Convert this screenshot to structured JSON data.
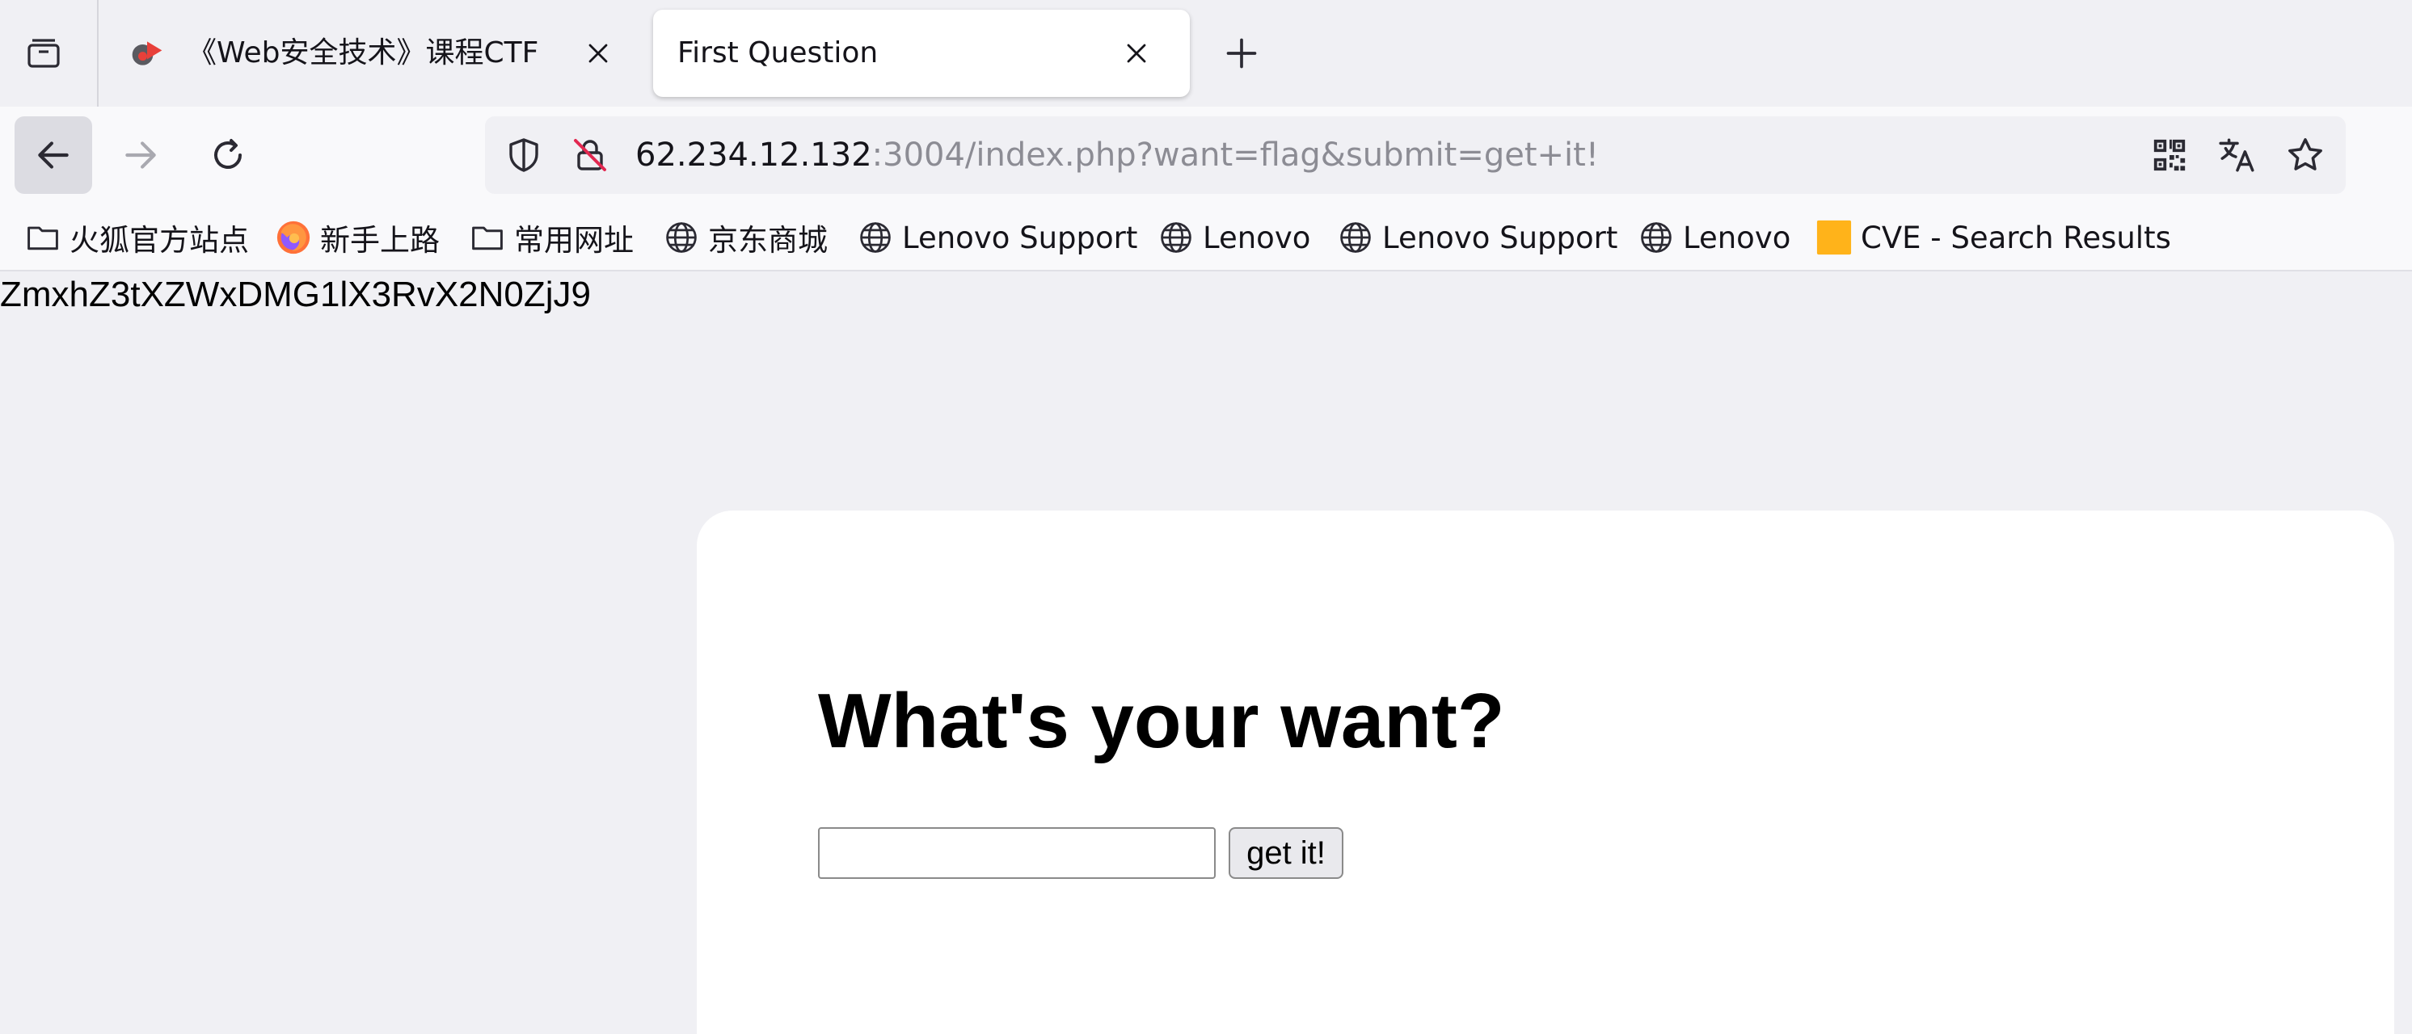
{
  "tabs": [
    {
      "title": "《Web安全技术》课程CTF",
      "active": false,
      "favicon": "red-play-favicon-icon"
    },
    {
      "title": "First Question",
      "active": true
    }
  ],
  "toolbar": {
    "tab_list_icon": "tab-list-icon",
    "new_tab_icon": "plus-icon",
    "back_icon": "arrow-left-icon",
    "forward_icon": "arrow-right-icon",
    "reload_icon": "reload-icon"
  },
  "urlbar": {
    "host": "62.234.12.132",
    "path": ":3004/index.php?want=flag&submit=get+it!",
    "left_icons": [
      "shield-icon",
      "insecure-lock-icon"
    ],
    "right_icons": [
      "qr-code-icon",
      "translate-icon",
      "star-icon"
    ]
  },
  "bookmarks": [
    {
      "label": "火狐官方站点",
      "icon": "folder-icon"
    },
    {
      "label": "新手上路",
      "icon": "firefox-icon"
    },
    {
      "label": "常用网址",
      "icon": "folder-icon"
    },
    {
      "label": "京东商城",
      "icon": "globe-icon"
    },
    {
      "label": "Lenovo Support",
      "icon": "globe-icon"
    },
    {
      "label": "Lenovo",
      "icon": "globe-icon"
    },
    {
      "label": "Lenovo Support",
      "icon": "globe-icon"
    },
    {
      "label": "Lenovo",
      "icon": "globe-icon"
    },
    {
      "label": "CVE - Search Results",
      "icon": "cve-square-icon"
    }
  ],
  "page": {
    "output": "ZmxhZ3tXZWxDMG1lX3RvX2N0ZjJ9",
    "heading": "What's your want?",
    "input_value": "",
    "submit_label": "get it!"
  },
  "colors": {
    "chrome_bg": "#f0f0f4",
    "toolbar_bg": "#f9f9fb",
    "cve_square": "#ffb31a",
    "favicon_red": "#e8403a"
  }
}
